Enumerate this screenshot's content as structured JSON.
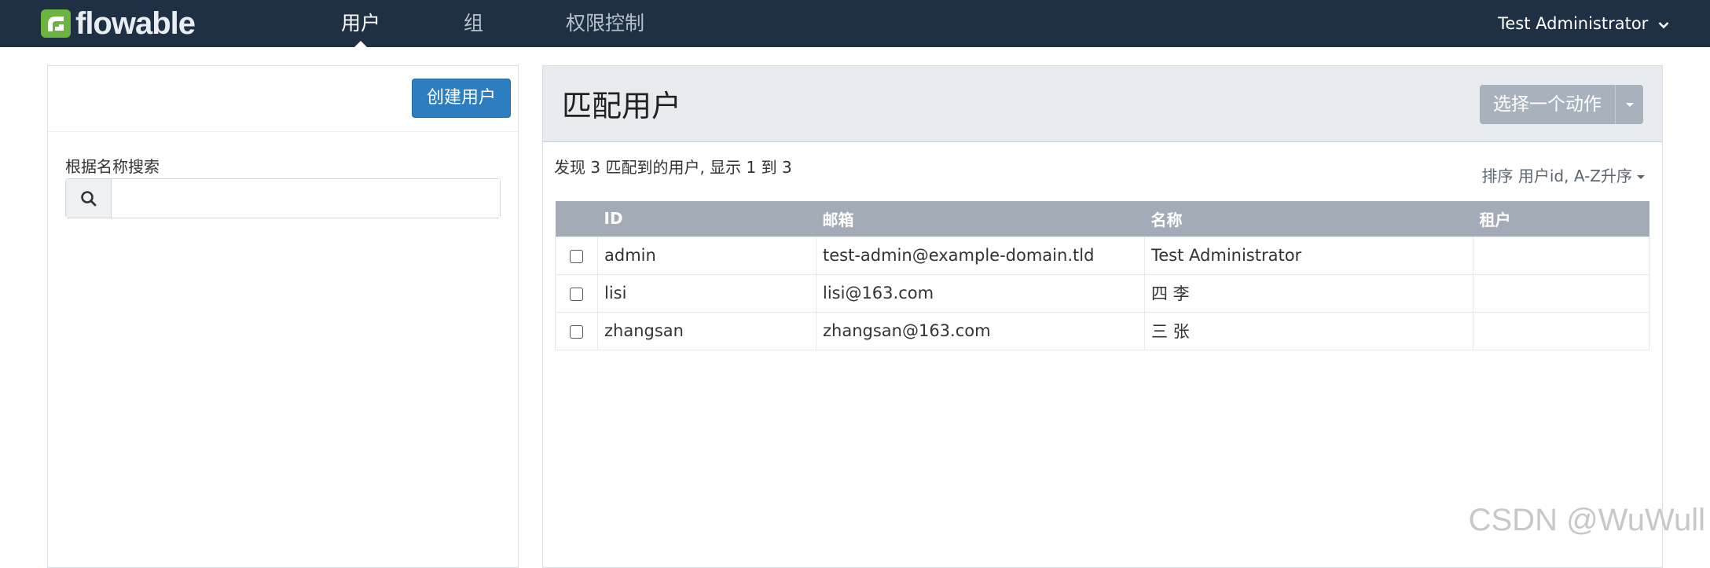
{
  "brand": {
    "name": "flowable"
  },
  "nav": {
    "items": [
      {
        "label": "用户",
        "active": true
      },
      {
        "label": "组",
        "active": false
      },
      {
        "label": "权限控制",
        "active": false
      }
    ],
    "user_menu": "Test Administrator"
  },
  "left": {
    "create_button": "创建用户",
    "search_label": "根据名称搜索",
    "search_value": "",
    "search_placeholder": ""
  },
  "right": {
    "title": "匹配用户",
    "action_button": "选择一个动作",
    "summary": "发现 3 匹配到的用户, 显示 1 到 3",
    "sort_label": "排序 用户id, A-Z升序"
  },
  "table": {
    "columns": [
      "ID",
      "邮箱",
      "名称",
      "租户"
    ],
    "rows": [
      {
        "checked": false,
        "id": "admin",
        "email": "test-admin@example-domain.tld",
        "name": "Test Administrator",
        "tenant": ""
      },
      {
        "checked": false,
        "id": "lisi",
        "email": "lisi@163.com",
        "name": "四 李",
        "tenant": ""
      },
      {
        "checked": false,
        "id": "zhangsan",
        "email": "zhangsan@163.com",
        "name": "三 张",
        "tenant": ""
      }
    ]
  },
  "watermark": "CSDN @WuWull",
  "colors": {
    "navbar": "#1f3045",
    "brand_green": "#6cb33f",
    "primary_button": "#2d7ec0",
    "table_header": "#a3abb6",
    "panel_header": "#e8ecf0"
  }
}
